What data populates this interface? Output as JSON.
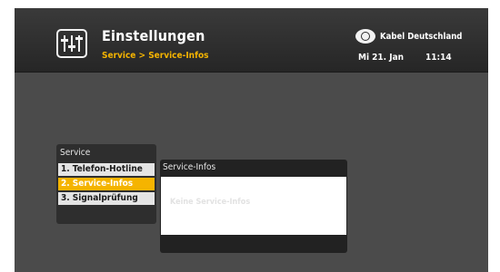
{
  "header": {
    "title": "Einstellungen",
    "breadcrumb": "Service > Service-Infos",
    "brand": "Kabel Deutschland",
    "date": "Mi 21. Jan",
    "time": "11:14",
    "icon": "equalizer-settings-icon",
    "brand_icon": "kabel-deutschland-eye-logo"
  },
  "service_menu": {
    "title": "Service",
    "items": [
      {
        "label": "1. Telefon-Hotline",
        "selected": false
      },
      {
        "label": "2. Service-Infos",
        "selected": true
      },
      {
        "label": "3. Signalprüfung",
        "selected": false
      }
    ]
  },
  "info_panel": {
    "title": "Service-Infos",
    "empty_message": "Keine Service-Infos"
  },
  "colors": {
    "accent": "#f5b400",
    "background": "#4b4b4b",
    "header": "#2b2b2b"
  }
}
